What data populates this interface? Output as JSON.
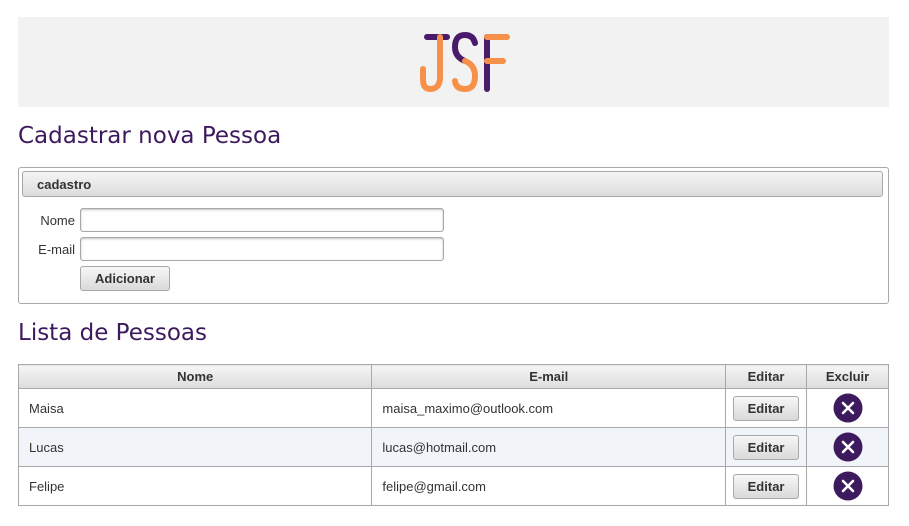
{
  "header": {
    "logo_text": "JSF"
  },
  "cadastro": {
    "title": "Cadastrar nova Pessoa",
    "panel_title": "cadastro",
    "nome_label": "Nome",
    "email_label": "E-mail",
    "nome_value": "",
    "email_value": "",
    "submit_label": "Adicionar"
  },
  "lista": {
    "title": "Lista de Pessoas",
    "columns": {
      "nome": "Nome",
      "email": "E-mail",
      "editar": "Editar",
      "excluir": "Excluir"
    },
    "rows": [
      {
        "nome": "Maisa",
        "email": "maisa_maximo@outlook.com",
        "edit_label": "Editar",
        "delete_icon": "close-circle-icon"
      },
      {
        "nome": "Lucas",
        "email": "lucas@hotmail.com",
        "edit_label": "Editar",
        "delete_icon": "close-circle-icon"
      },
      {
        "nome": "Felipe",
        "email": "felipe@gmail.com",
        "edit_label": "Editar",
        "delete_icon": "close-circle-icon"
      }
    ]
  },
  "colors": {
    "accent_purple": "#3d1a5e",
    "logo_orange": "#f7914a",
    "logo_purple": "#4a1a6b",
    "header_bg": "#f2f2f2",
    "row_alt_bg": "#f1f4f9"
  }
}
